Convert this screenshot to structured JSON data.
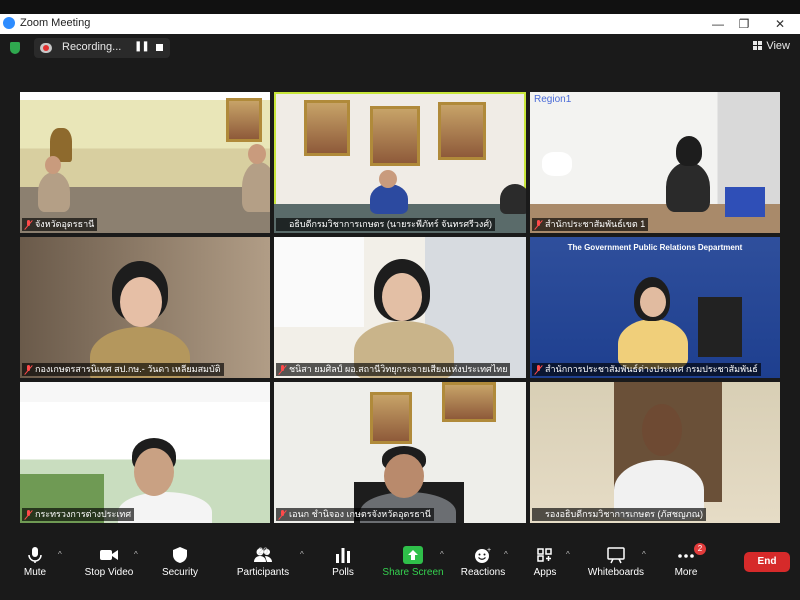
{
  "window": {
    "title": "Zoom Meeting",
    "minimize": "—",
    "maximize": "❐",
    "close": "✕"
  },
  "meeting_bar": {
    "recording_label": "Recording...",
    "pause": "❚❚",
    "view_label": "View"
  },
  "tiles": [
    {
      "name": "จังหวัดอุดรธานี",
      "muted": true,
      "active": false
    },
    {
      "name": "อธิบดีกรมวิชาการเกษตร (นายระพีภัทร์ จันทรศรีวงศ์)",
      "muted": false,
      "active": true
    },
    {
      "name": "สำนักประชาสัมพันธ์เขต 1",
      "muted": true,
      "active": false
    },
    {
      "name": "กองเกษตรสารนิเทศ สป.กษ.- วันดา เหลียมสมบัติ",
      "muted": true,
      "active": false
    },
    {
      "name": "ชนิสา ยมศิลป์ ผอ.สถานีวิทยุกระจายเสียงแห่งประเทศไทย",
      "muted": true,
      "active": false
    },
    {
      "name": "สำนักการประชาสัมพันธ์ต่างประเทศ กรมประชาสัมพันธ์",
      "muted": true,
      "active": false
    },
    {
      "name": "กระทรวงการต่างประเทศ",
      "muted": true,
      "active": false
    },
    {
      "name": "เอนก ชำนิจอง เกษตรจังหวัดอุดรธานี",
      "muted": true,
      "active": false
    },
    {
      "name": "รองอธิบดีกรมวิชาการเกษตร (ภัสชญภณ)",
      "muted": false,
      "active": false
    }
  ],
  "tile_text": {
    "gpr_banner": "The Government Public Relations Department",
    "region_sign": "Region1"
  },
  "toolbar": {
    "mute": "Mute",
    "stop_video": "Stop Video",
    "security": "Security",
    "participants": "Participants",
    "participants_count": "20",
    "polls": "Polls",
    "share_screen": "Share Screen",
    "reactions": "Reactions",
    "apps": "Apps",
    "whiteboards": "Whiteboards",
    "more": "More",
    "more_badge": "2",
    "end": "End"
  },
  "colors": {
    "active_speaker": "#c8e63a",
    "share_green": "#35d04f",
    "end_red": "#d62a2a"
  }
}
